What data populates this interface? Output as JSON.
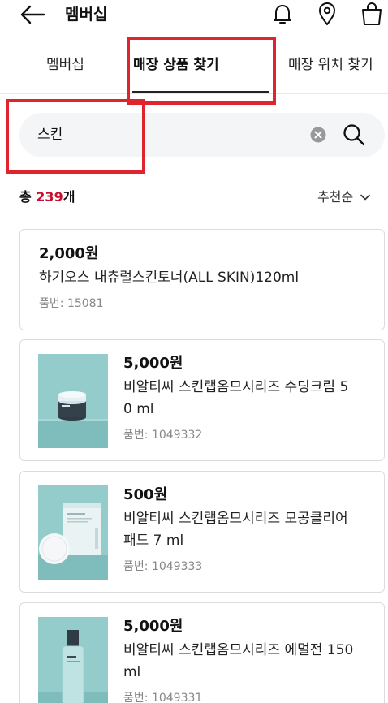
{
  "header": {
    "title": "멤버십",
    "icons": [
      "back-arrow-icon",
      "bell-icon",
      "location-pin-icon",
      "shopping-bag-icon"
    ]
  },
  "tabs": [
    {
      "label": "멤버십",
      "active": false
    },
    {
      "label": "매장 상품 찾기",
      "active": true
    },
    {
      "label": "매장 위치 찾기",
      "active": false
    }
  ],
  "search": {
    "value": "스킨",
    "icons": [
      "clear-icon",
      "search-icon"
    ]
  },
  "summary": {
    "prefix": "총 ",
    "count": "239",
    "suffix": "개",
    "sort_label": "추천순"
  },
  "products": [
    {
      "price": "2,000원",
      "name": "하기오스 내츄럴스킨토너(ALL SKIN)120ml",
      "code_label": "품번: ",
      "code": "15081",
      "has_image": false
    },
    {
      "price": "5,000원",
      "name_line1": "비알티씨 스킨랩옴므시리즈 수딩크림 5",
      "name_line2": "0 ml",
      "code_label": "품번: ",
      "code": "1049332",
      "has_image": true
    },
    {
      "price": "500원",
      "name_line1": "비알티씨 스킨랩옴므시리즈 모공클리어",
      "name_line2": "패드 7 ml",
      "code_label": "품번: ",
      "code": "1049333",
      "has_image": true
    },
    {
      "price": "5,000원",
      "name_line1": "비알티씨 스킨랩옴므시리즈 에멀전 150",
      "name_line2": "ml",
      "code_label": "품번: ",
      "code": "1049331",
      "has_image": true
    }
  ],
  "colors": {
    "accent": "#c8102e",
    "highlight_box": "#e0242e",
    "search_bg": "#f4f5f7",
    "thumb_teal": "#8fc9c9"
  }
}
